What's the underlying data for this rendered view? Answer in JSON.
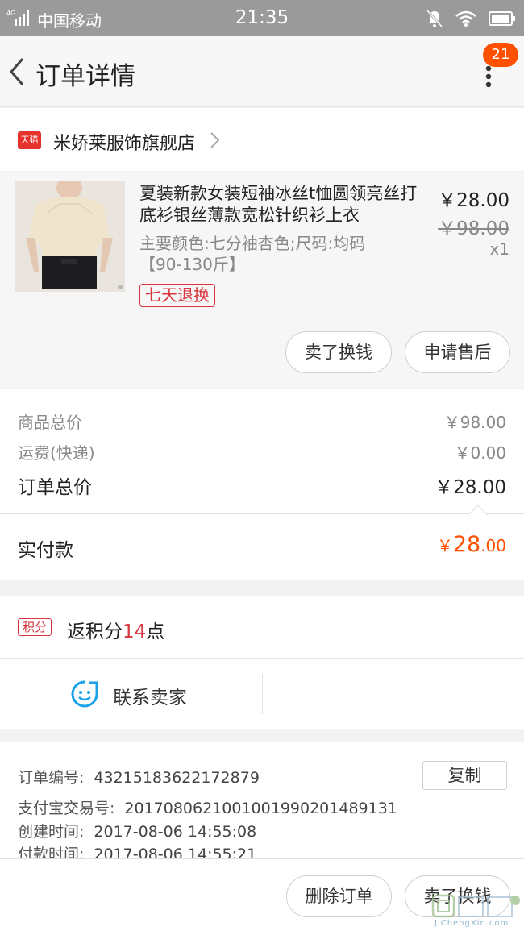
{
  "status_bar": {
    "network": "4G",
    "carrier": "中国移动",
    "time": "21:35"
  },
  "header": {
    "title": "订单详情",
    "badge_count": "21"
  },
  "shop": {
    "badge": "天猫",
    "name": "米娇莱服饰旗舰店"
  },
  "item": {
    "title": "夏装新款女装短袖冰丝t恤圆领亮丝打底衫银丝薄款宽松针织衫上衣",
    "sku": "主要颜色:七分袖杏色;尺码:均码【90-130斤】",
    "tag": "七天退换",
    "price": "￥28.00",
    "original_price": "￥98.00",
    "quantity": "x1",
    "buttons": {
      "sell": "卖了换钱",
      "after_sales": "申请售后"
    }
  },
  "summary": {
    "goods_total_label": "商品总价",
    "goods_total_value": "￥98.00",
    "shipping_label": "运费(快递)",
    "shipping_value": "￥0.00",
    "order_total_label": "订单总价",
    "order_total_value": "￥28.00"
  },
  "payment": {
    "label": "实付款",
    "currency": "￥",
    "integer": "28",
    "decimal": ".00"
  },
  "points": {
    "badge": "积分",
    "prefix": "返积分",
    "amount": "14",
    "suffix": "点"
  },
  "contact": {
    "label": "联系卖家"
  },
  "order_info": {
    "order_no_label": "订单编号:",
    "order_no": "43215183622172879",
    "copy_label": "复制",
    "alipay_label": "支付宝交易号:",
    "alipay_no": "20170806210010019902014891​31",
    "created_label": "创建时间:",
    "created_time": "2017-08-06 14:55:08",
    "paid_label": "付款时间:",
    "paid_time": "2017-08-06 14:55:21"
  },
  "bottom_bar": {
    "delete_label": "删除订单",
    "sell_label": "卖了换钱"
  },
  "watermark": {
    "text": "JiChengXin.com"
  },
  "colors": {
    "accent": "#ff5000",
    "tmall_red": "#e5322d",
    "tag_red": "#d8343d",
    "contact_blue": "#1aa3e8",
    "status_bar": "#9a9a9a"
  }
}
